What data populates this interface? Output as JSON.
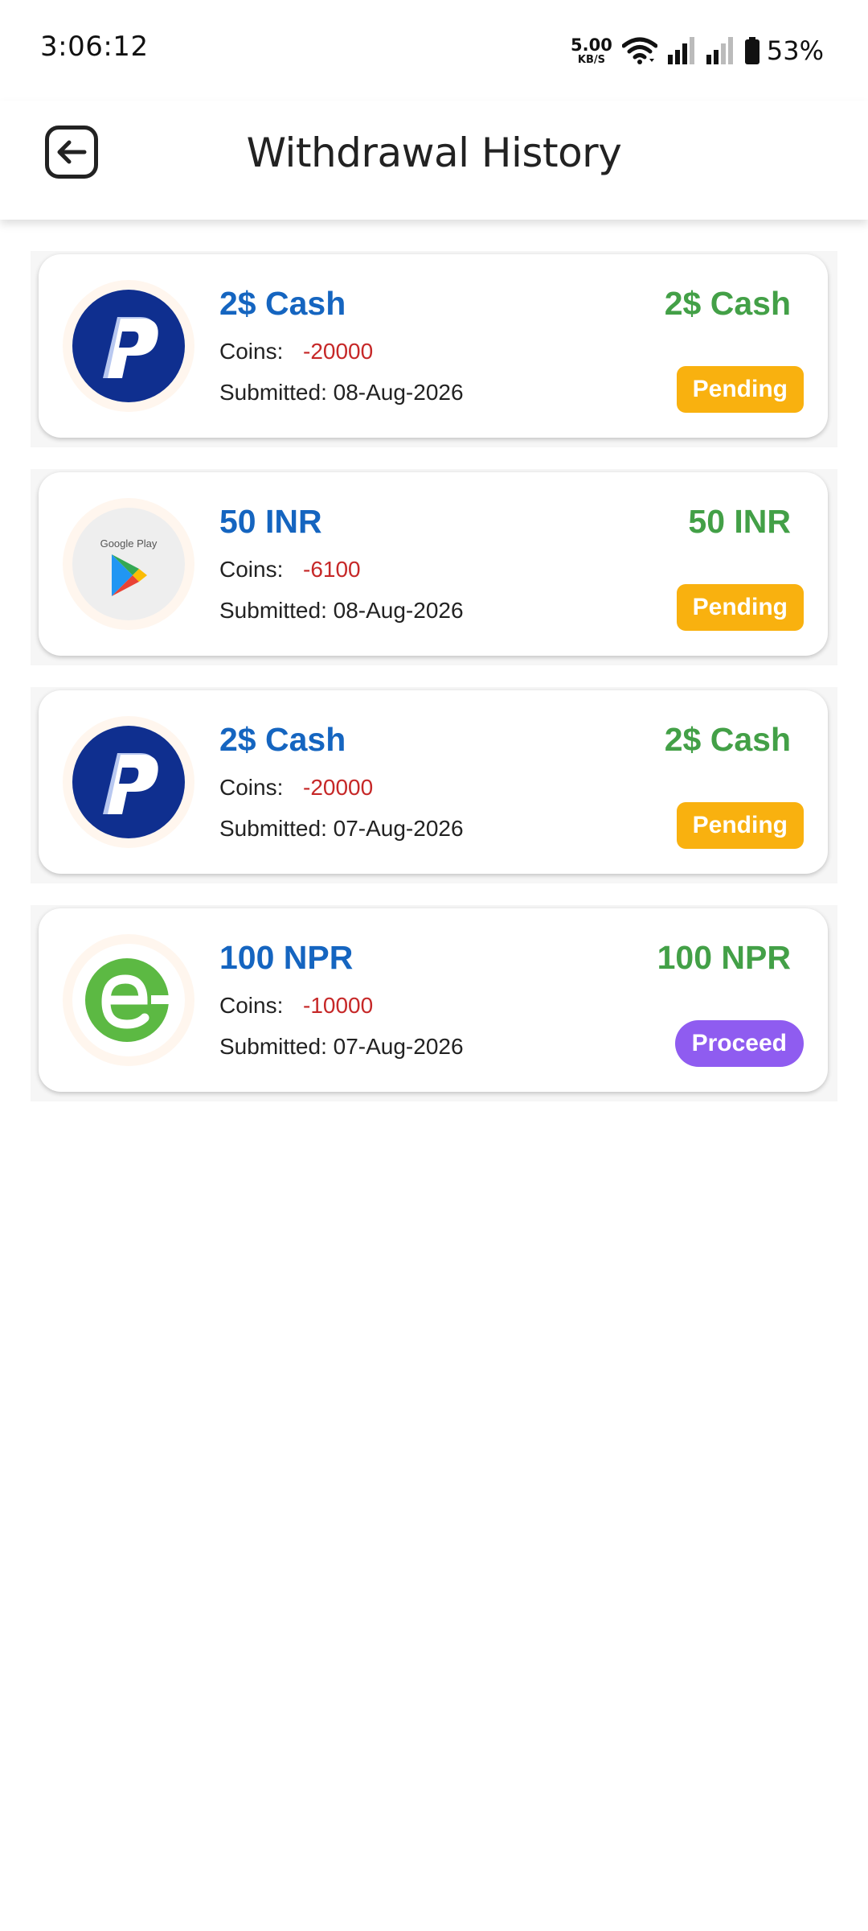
{
  "status_bar": {
    "time": "3:06:12",
    "net_speed_value": "5.00",
    "net_speed_unit": "KB/S",
    "battery_percent": "53%"
  },
  "header": {
    "title": "Withdrawal History",
    "back_icon": "back-arrow-icon"
  },
  "labels": {
    "coins": "Coins:",
    "submitted_prefix": "Submitted: "
  },
  "colors": {
    "title_blue": "#1565c0",
    "amount_green": "#43a047",
    "coins_red": "#c62828",
    "pending_bg": "#f9b10f",
    "proceed_bg": "#8f5cf0"
  },
  "withdrawals": [
    {
      "title": "2$ Cash",
      "coins": "-20000",
      "submitted": "Submitted: 08-Aug-2026",
      "amount": "2$ Cash",
      "status": "Pending",
      "logo": "paypal-logo-icon"
    },
    {
      "title": "50 INR",
      "coins": "-6100",
      "submitted": "Submitted: 08-Aug-2026",
      "amount": "50 INR",
      "status": "Pending",
      "logo": "google-play-logo-icon",
      "logo_text": "Google Play"
    },
    {
      "title": "2$ Cash",
      "coins": "-20000",
      "submitted": "Submitted: 07-Aug-2026",
      "amount": "2$ Cash",
      "status": "Pending",
      "logo": "paypal-logo-icon"
    },
    {
      "title": "100 NPR",
      "coins": "-10000",
      "submitted": "Submitted: 07-Aug-2026",
      "amount": "100 NPR",
      "status": "Proceed",
      "logo": "esewa-logo-icon"
    }
  ]
}
